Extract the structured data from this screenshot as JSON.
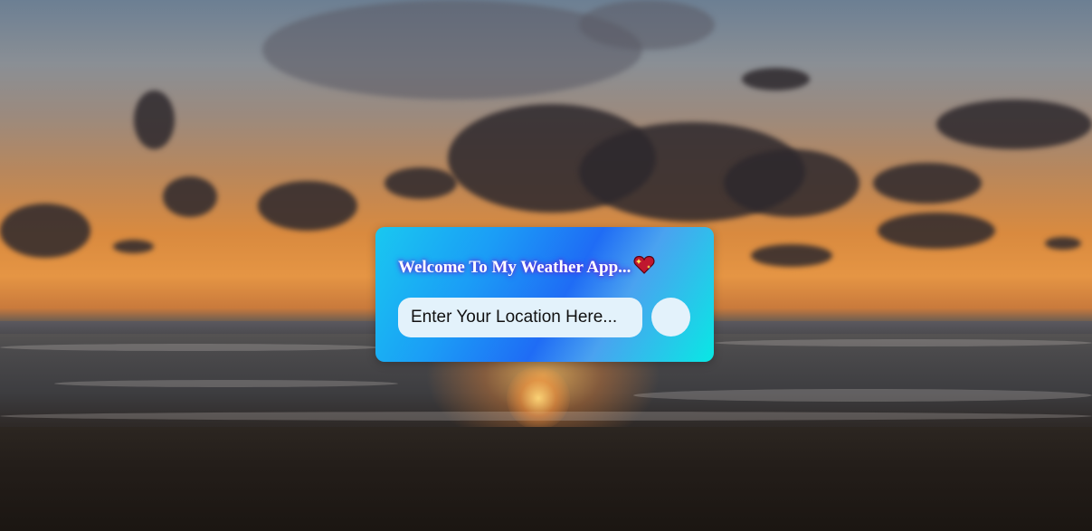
{
  "background": {
    "scene": "sunset-over-ocean"
  },
  "card": {
    "title": "Welcome To My Weather App...",
    "title_icon": "sparkling-heart-icon",
    "search": {
      "placeholder": "Enter Your Location Here...",
      "value": ""
    },
    "search_button_icon": "circle-button"
  },
  "colors": {
    "card_gradient_start": "#19c8f0",
    "card_gradient_mid": "#1f6cf5",
    "card_gradient_end": "#08e8e4",
    "input_bg": "#e3f2fb",
    "title_glow": "#5b2bd9"
  }
}
